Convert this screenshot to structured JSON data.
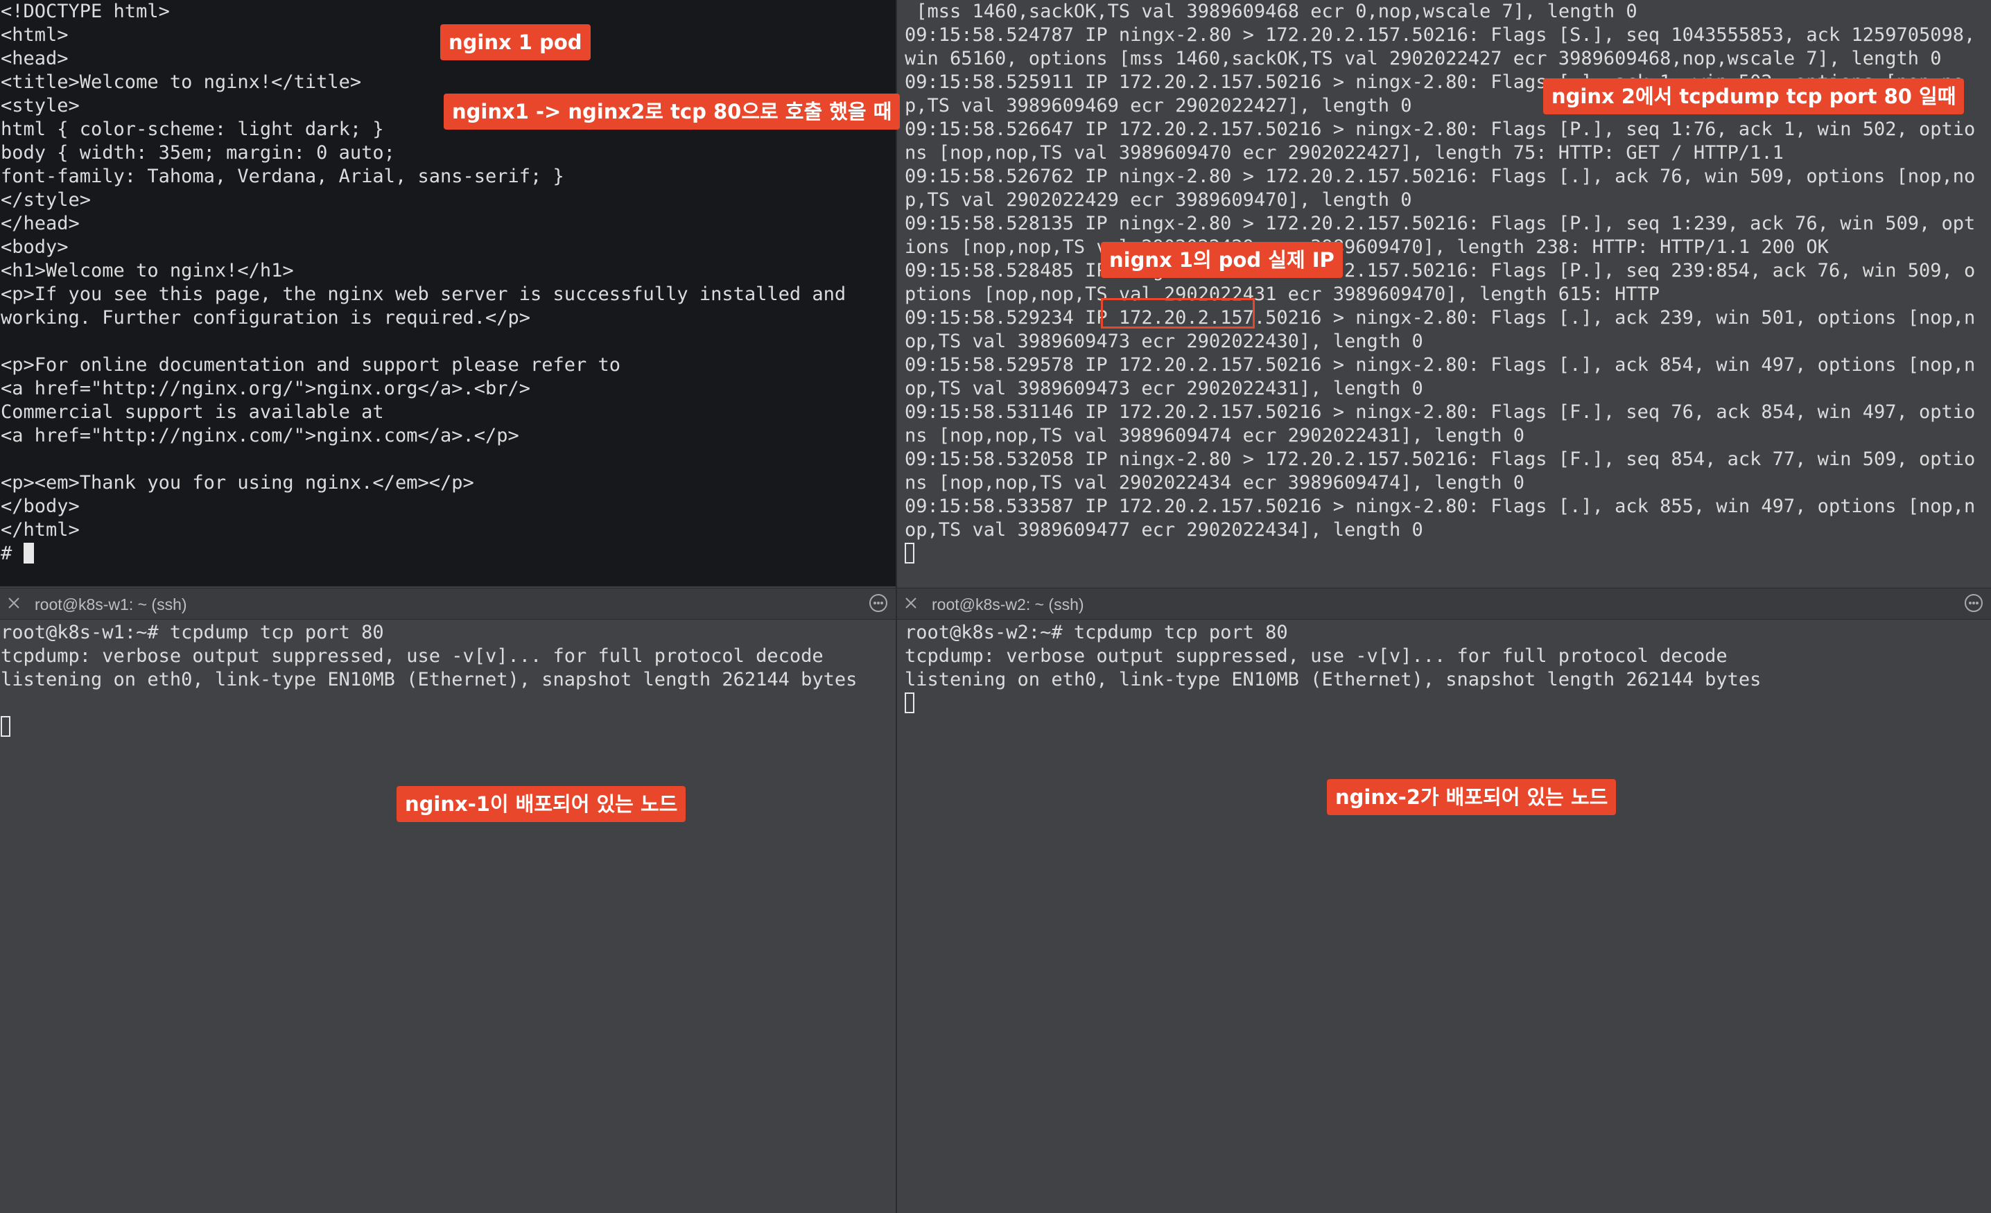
{
  "top_left_terminal": {
    "lines": [
      "<!DOCTYPE html>",
      "<html>",
      "<head>",
      "<title>Welcome to nginx!</title>",
      "<style>",
      "html { color-scheme: light dark; }",
      "body { width: 35em; margin: 0 auto;",
      "font-family: Tahoma, Verdana, Arial, sans-serif; }",
      "</style>",
      "</head>",
      "<body>",
      "<h1>Welcome to nginx!</h1>",
      "<p>If you see this page, the nginx web server is successfully installed and",
      "working. Further configuration is required.</p>",
      "",
      "<p>For online documentation and support please refer to",
      "<a href=\"http://nginx.org/\">nginx.org</a>.<br/>",
      "Commercial support is available at",
      "<a href=\"http://nginx.com/\">nginx.com</a>.</p>",
      "",
      "<p><em>Thank you for using nginx.</em></p>",
      "</body>",
      "</html>"
    ],
    "prompt": "# "
  },
  "top_right_terminal": {
    "lines": [
      " [mss 1460,sackOK,TS val 3989609468 ecr 0,nop,wscale 7], length 0",
      "09:15:58.524787 IP ningx-2.80 > 172.20.2.157.50216: Flags [S.], seq 1043555853, ack 1259705098, win 65160, options [mss 1460,sackOK,TS val 2902022427 ecr 3989609468,nop,wscale 7], length 0",
      "09:15:58.525911 IP 172.20.2.157.50216 > ningx-2.80: Flags [.], ack 1, win 502, options [nop,nop,TS val 3989609469 ecr 2902022427], length 0",
      "09:15:58.526647 IP 172.20.2.157.50216 > ningx-2.80: Flags [P.], seq 1:76, ack 1, win 502, options [nop,nop,TS val 3989609470 ecr 2902022427], length 75: HTTP: GET / HTTP/1.1",
      "09:15:58.526762 IP ningx-2.80 > 172.20.2.157.50216: Flags [.], ack 76, win 509, options [nop,nop,TS val 2902022429 ecr 3989609470], length 0",
      "09:15:58.528135 IP ningx-2.80 > 172.20.2.157.50216: Flags [P.], seq 1:239, ack 76, win 509, options [nop,nop,TS val 2902022429 ecr 3989609470], length 238: HTTP: HTTP/1.1 200 OK",
      "09:15:58.528485 IP ningx-2.80 > 172.20.2.157.50216: Flags [P.], seq 239:854, ack 76, win 509, options [nop,nop,TS val 2902022431 ecr 3989609470], length 615: HTTP",
      "09:15:58.529234 IP 172.20.2.157.50216 > ningx-2.80: Flags [.], ack 239, win 501, options [nop,nop,TS val 3989609473 ecr 2902022430], length 0",
      "09:15:58.529578 IP 172.20.2.157.50216 > ningx-2.80: Flags [.], ack 854, win 497, options [nop,nop,TS val 3989609473 ecr 2902022431], length 0",
      "09:15:58.531146 IP 172.20.2.157.50216 > ningx-2.80: Flags [F.], seq 76, ack 854, win 497, options [nop,nop,TS val 3989609474 ecr 2902022431], length 0",
      "09:15:58.532058 IP ningx-2.80 > 172.20.2.157.50216: Flags [F.], seq 854, ack 77, win 509, options [nop,nop,TS val 2902022434 ecr 3989609474], length 0",
      "09:15:58.533587 IP 172.20.2.157.50216 > ningx-2.80: Flags [.], ack 855, win 497, options [nop,nop,TS val 3989609477 ecr 2902022434], length 0"
    ]
  },
  "bottom_left_tab": {
    "title": "root@k8s-w1: ~ (ssh)"
  },
  "bottom_right_tab": {
    "title": "root@k8s-w2: ~ (ssh)"
  },
  "bottom_left_terminal": {
    "lines": [
      "root@k8s-w1:~# tcpdump tcp port 80",
      "tcpdump: verbose output suppressed, use -v[v]... for full protocol decode",
      "listening on eth0, link-type EN10MB (Ethernet), snapshot length 262144 bytes",
      ""
    ]
  },
  "bottom_right_terminal": {
    "lines": [
      "root@k8s-w2:~# tcpdump tcp port 80",
      "tcpdump: verbose output suppressed, use -v[v]... for full protocol decode",
      "listening on eth0, link-type EN10MB (Ethernet), snapshot length 262144 bytes"
    ]
  },
  "annotations": {
    "nginx1_pod": "nginx 1 pod",
    "call_description": "nginx1 -> nginx2로 tcp 80으로 호출 했을 때",
    "tcpdump_description": "nginx 2에서 tcpdump tcp port 80 일때",
    "pod_ip_description": "nignx 1의 pod 실제 IP",
    "node1_description": "nginx-1이 배포되어 있는 노드",
    "node2_description": "nginx-2가 배포되어 있는 노드"
  },
  "colors": {
    "callout": "#e8472b",
    "terminal_dark_bg": "#16181c",
    "terminal_gray_bg": "#414246",
    "terminal_text": "#dcdcdc"
  }
}
